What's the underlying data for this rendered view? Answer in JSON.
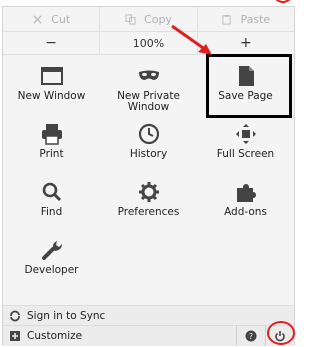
{
  "edit": {
    "cut": "Cut",
    "copy": "Copy",
    "paste": "Paste"
  },
  "zoom": {
    "minus": "−",
    "level": "100%",
    "plus": "+"
  },
  "tiles": [
    {
      "label": "New Window",
      "icon": "new-window-icon"
    },
    {
      "label": "New Private Window",
      "icon": "private-mask-icon"
    },
    {
      "label": "Save Page",
      "icon": "save-page-icon"
    },
    {
      "label": "Print",
      "icon": "print-icon"
    },
    {
      "label": "History",
      "icon": "history-clock-icon"
    },
    {
      "label": "Full Screen",
      "icon": "full-screen-icon"
    },
    {
      "label": "Find",
      "icon": "search-icon"
    },
    {
      "label": "Preferences",
      "icon": "gear-icon"
    },
    {
      "label": "Add-ons",
      "icon": "puzzle-icon"
    },
    {
      "label": "Developer",
      "icon": "wrench-icon"
    }
  ],
  "footer": {
    "sync": "Sign in to Sync",
    "customize": "Customize"
  },
  "annotations": {
    "arrow_color": "#e02020",
    "box_color": "#000000"
  }
}
